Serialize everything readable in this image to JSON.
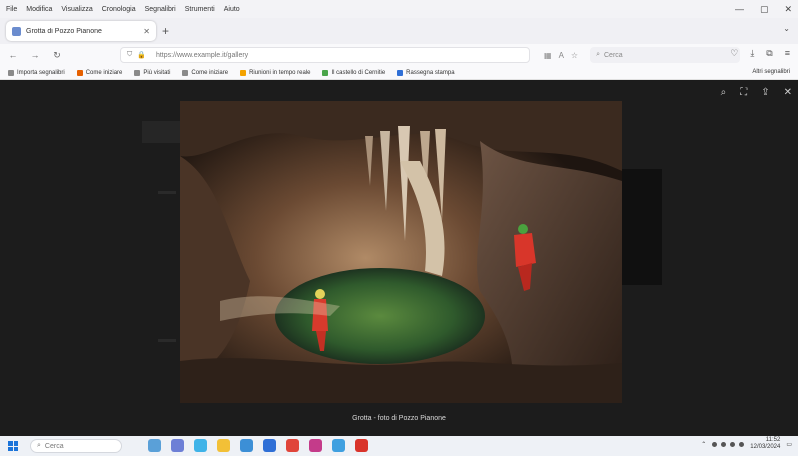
{
  "browser": {
    "menu": [
      "File",
      "Modifica",
      "Visualizza",
      "Cronologia",
      "Segnalibri",
      "Strumenti",
      "Aiuto"
    ],
    "tab_title": "Grotta di Pozzo Pianone",
    "url_domain": "",
    "url_text": "https://www.example.it/gallery",
    "search_placeholder": "Cerca",
    "bookmarks": [
      "Importa segnalibri",
      "Come iniziare",
      "Più visitati",
      "Come iniziare",
      "Riunioni in tempo reale",
      "Il castello di Cernitie",
      "Rassegna stampa"
    ],
    "bookmarks_other": "Altri segnalibri"
  },
  "lightbox": {
    "caption": "Grotta - foto di Pozzo Pianone"
  },
  "taskbar": {
    "search_placeholder": "Cerca",
    "time": "11:52",
    "date": "12/03/2024"
  },
  "colors": {
    "accent": "#1a73d9",
    "lightbox_bg": "#1c1c1c"
  }
}
